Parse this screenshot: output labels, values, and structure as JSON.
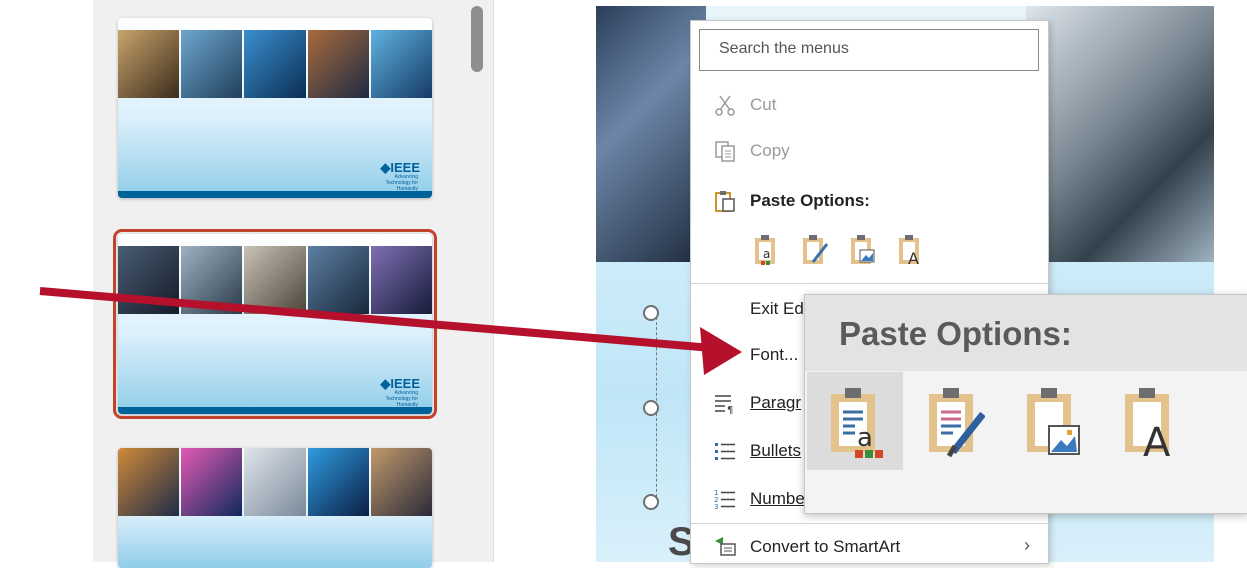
{
  "slides_pane": {
    "thumbnails": [
      {
        "logo": "◆IEEE",
        "tagline": "Advancing Technology for Humanity",
        "selected": false
      },
      {
        "logo": "◆IEEE",
        "tagline": "Advancing Technology for Humanity",
        "selected": true
      },
      {
        "logo": "",
        "tagline": "",
        "selected": false
      }
    ]
  },
  "context_menu": {
    "search_placeholder": "Search the menus",
    "cut": "Cut",
    "copy": "Copy",
    "paste_options_heading": "Paste Options:",
    "exit_edit": "Exit Ed",
    "font": "Font...",
    "paragraph": "Paragr",
    "bullets": "Bullets",
    "numbering": "Numbe",
    "convert_smartart": "Convert to SmartArt",
    "submenu_arrow": "›"
  },
  "paste_zoom": {
    "title": "Paste Options:"
  },
  "slide_text": {
    "big_letter": "S"
  },
  "colors": {
    "selection_outline": "#c0432b",
    "callout_arrow": "#b5102c",
    "ieee_blue": "#00629b",
    "clipboard_tan": "#e3c28e"
  }
}
